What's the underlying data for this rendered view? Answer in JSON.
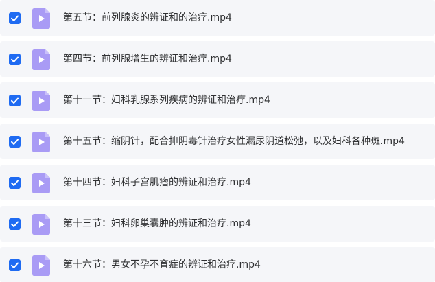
{
  "colors": {
    "row_background": "#f5f6f9",
    "checkbox": "#1f6bf2",
    "file_icon": "#a99bf5",
    "file_icon_fold": "#c9c0fa",
    "text": "#303133"
  },
  "files": [
    {
      "name": "第五节：前列腺炎的辨证和的治疗.mp4",
      "checked": true,
      "icon": "video-file-icon"
    },
    {
      "name": "第四节：前列腺增生的辨证和治疗.mp4",
      "checked": true,
      "icon": "video-file-icon"
    },
    {
      "name": "第十一节：妇科乳腺系列疾病的辨证和治疗.mp4",
      "checked": true,
      "icon": "video-file-icon"
    },
    {
      "name": "第十五节：缩阴针，配合排阴毒针治疗女性漏尿阴道松弛，以及妇科各种斑.mp4",
      "checked": true,
      "icon": "video-file-icon"
    },
    {
      "name": "第十四节：妇科子宫肌瘤的辨证和治疗.mp4",
      "checked": true,
      "icon": "video-file-icon"
    },
    {
      "name": "第十三节：妇科卵巢囊肿的辨证和治疗.mp4",
      "checked": true,
      "icon": "video-file-icon"
    },
    {
      "name": "第十六节：男女不孕不育症的辨证和治疗.mp4",
      "checked": true,
      "icon": "video-file-icon"
    }
  ]
}
